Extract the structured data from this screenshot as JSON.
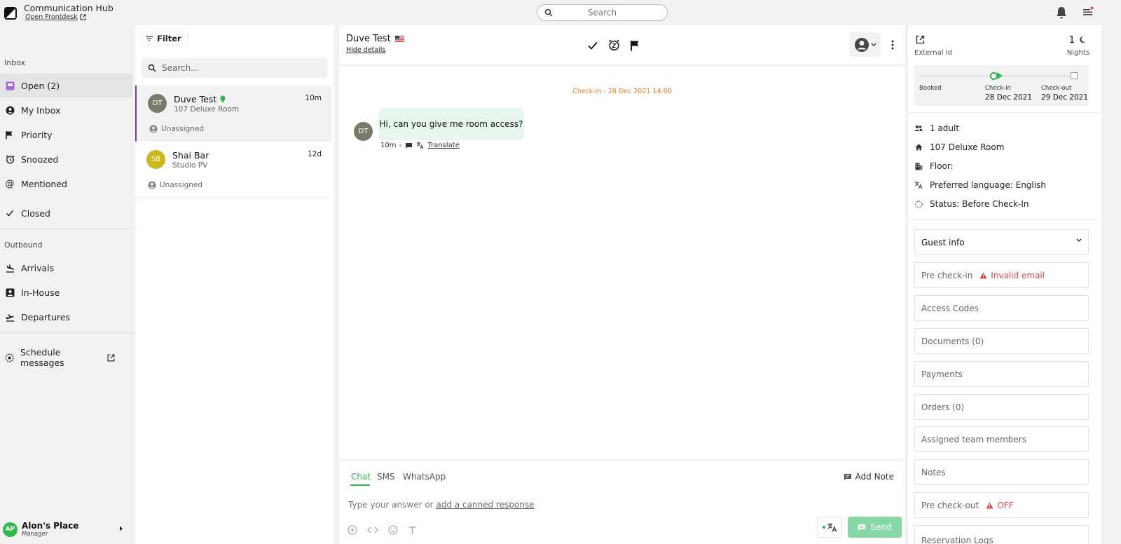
{
  "app": {
    "title": "Communication Hub",
    "link": "Open Frontdesk"
  },
  "search": {
    "placeholder": "Search"
  },
  "sidebar": {
    "inbox_label": "Inbox",
    "inbox_items": [
      {
        "label": "Open (2)",
        "icon": "open-inbox-icon"
      },
      {
        "label": "My Inbox",
        "icon": "user-circle-icon"
      },
      {
        "label": "Priority",
        "icon": "flag-icon"
      },
      {
        "label": "Snoozed",
        "icon": "alarm-icon"
      },
      {
        "label": "Mentioned",
        "icon": "at-icon"
      },
      {
        "label": "Closed",
        "icon": "check-icon"
      }
    ],
    "outbound_label": "Outbound",
    "outbound_items": [
      {
        "label": "Arrivals",
        "icon": "plane-landing-icon"
      },
      {
        "label": "In-House",
        "icon": "contact-icon"
      },
      {
        "label": "Departures",
        "icon": "plane-takeoff-icon"
      }
    ],
    "schedule_label": "Schedule messages",
    "account": {
      "initials": "AP",
      "name": "Alon's Place",
      "role": "Manager"
    }
  },
  "conversations": {
    "filter_label": "Filter",
    "search_placeholder": "Search...",
    "items": [
      {
        "initials": "DT",
        "name": "Duve Test",
        "room": "107 Deluxe Room",
        "time": "10m",
        "assignee": "Unassigned",
        "avatar_color": "#7a7a6c"
      },
      {
        "initials": "SB",
        "name": "Shai Bar",
        "room": "Studio PV",
        "time": "12d",
        "assignee": "Unassigned",
        "avatar_color": "#c9b81e"
      }
    ]
  },
  "chat": {
    "guest_name": "Duve Test",
    "hide_details": "Hide details",
    "date_marker": "Check-in - 28 Dec 2021 14:00",
    "message": {
      "initials": "DT",
      "text": "Hi, can you give me room access?",
      "time": "10m",
      "translate": "Translate"
    },
    "tabs": [
      "Chat",
      "SMS",
      "WhatsApp"
    ],
    "add_note": "Add Note",
    "composer_placeholder": "Type your answer or ",
    "canned_link": "add a canned response",
    "send_label": "Send"
  },
  "reservation": {
    "external_id_label": "External Id",
    "nights_count": "1",
    "nights_label": "Nights",
    "timeline": {
      "booked_label": "Booked",
      "checkin_label": "Check-in",
      "checkin_date": "28 Dec 2021",
      "checkout_label": "Check-out",
      "checkout_date": "29 Dec 2021"
    },
    "details": [
      {
        "text": "1 adult",
        "icon": "people-icon"
      },
      {
        "text": "107 Deluxe Room",
        "icon": "home-icon"
      },
      {
        "text": "Floor:",
        "icon": "building-icon"
      },
      {
        "text": "Preferred language: English",
        "icon": "translate-icon"
      },
      {
        "text": "Status: Before Check-In",
        "icon": "status-icon"
      }
    ],
    "sections": {
      "guest_info": "Guest info",
      "pre_checkin": "Pre check-in",
      "pre_checkin_warning": "Invalid email",
      "access_codes": "Access Codes",
      "documents": "Documents (0)",
      "payments": "Payments",
      "orders": "Orders (0)",
      "assigned_team": "Assigned team members",
      "notes": "Notes",
      "pre_checkout": "Pre check-out",
      "pre_checkout_warning": "OFF",
      "reservation_logs": "Reservation Logs"
    }
  },
  "colors": {
    "accent": "#2fb84b",
    "warning": "#e04848",
    "date_marker": "#e87d1e",
    "selected_border": "#6b3f9a"
  }
}
